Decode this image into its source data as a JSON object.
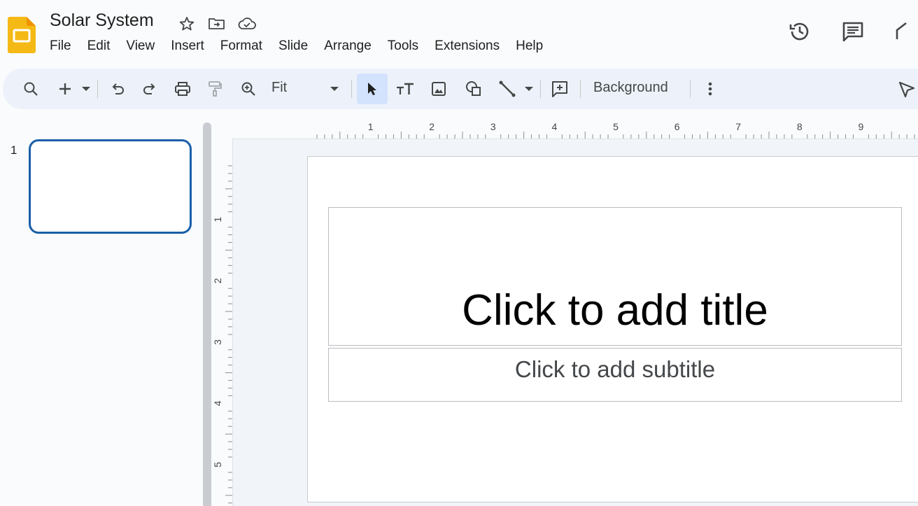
{
  "document": {
    "title": "Solar System"
  },
  "menu": [
    "File",
    "Edit",
    "View",
    "Insert",
    "Format",
    "Slide",
    "Arrange",
    "Tools",
    "Extensions",
    "Help"
  ],
  "toolbar": {
    "zoom_value": "Fit",
    "background_label": "Background"
  },
  "filmstrip": {
    "slide_number": "1"
  },
  "rulers": {
    "horizontal_ticks": [
      "1",
      "2",
      "3",
      "4",
      "5",
      "6",
      "7",
      "8",
      "9"
    ],
    "vertical_ticks": [
      "1",
      "2",
      "3",
      "4",
      "5"
    ]
  },
  "slide": {
    "title_placeholder": "Click to add title",
    "subtitle_placeholder": "Click to add subtitle"
  },
  "icons": {
    "app": "slides-logo-icon",
    "star": "star-icon",
    "move": "move-to-folder-icon",
    "cloud": "cloud-saved-icon",
    "history": "history-icon",
    "comments": "comments-icon"
  },
  "colors": {
    "brand": "#f5b915",
    "accent": "#0b57d0",
    "toolbar_bg": "#edf2fa",
    "selected_tool": "#d3e3fd"
  }
}
